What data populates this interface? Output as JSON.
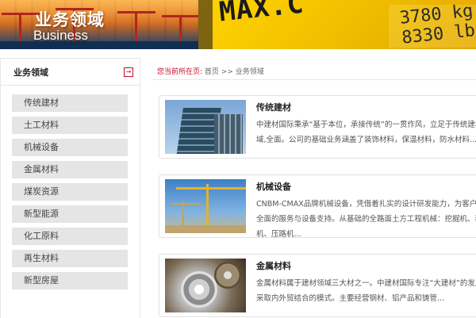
{
  "banner": {
    "title_cn": "业务领域",
    "title_en": "Business",
    "sign_text": "MAX.C",
    "sign_kg": "3780 kg",
    "sign_lb": "8330 lb"
  },
  "sidebar": {
    "title": "业务领域",
    "icon": "arrow-right-box-icon",
    "items": [
      {
        "label": "传统建材"
      },
      {
        "label": "土工材料"
      },
      {
        "label": "机械设备"
      },
      {
        "label": "金属材料"
      },
      {
        "label": "煤炭资源"
      },
      {
        "label": "新型能源"
      },
      {
        "label": "化工原料"
      },
      {
        "label": "再生材料"
      },
      {
        "label": "新型房屋"
      }
    ]
  },
  "breadcrumb": {
    "prefix": "您当前所在页:",
    "home": "首页",
    "sep": ">>",
    "current": "业务领域"
  },
  "cards": [
    {
      "title": "传统建材",
      "desc": "中建材国际秉承“基于本位，承接传统”的一贯作风，立足于传统建材领域,全面。公司的基础业务涵盖了装饰材料，保温材料，防水材料..."
    },
    {
      "title": "机械设备",
      "desc": "CNBM-CMAX品牌机械设备，凭借着扎实的设计研发能力，为客户提供全面的服务与设备支持。从基础的全路面土方工程机械：挖掘机、装载机、压路机..."
    },
    {
      "title": "金属材料",
      "desc": "金属材料属于建材领域三大材之一。中建材国际专注“大建材”的发展，采取内外贸结合的模式。主要经营钢材、铝产品和铸管..."
    }
  ]
}
